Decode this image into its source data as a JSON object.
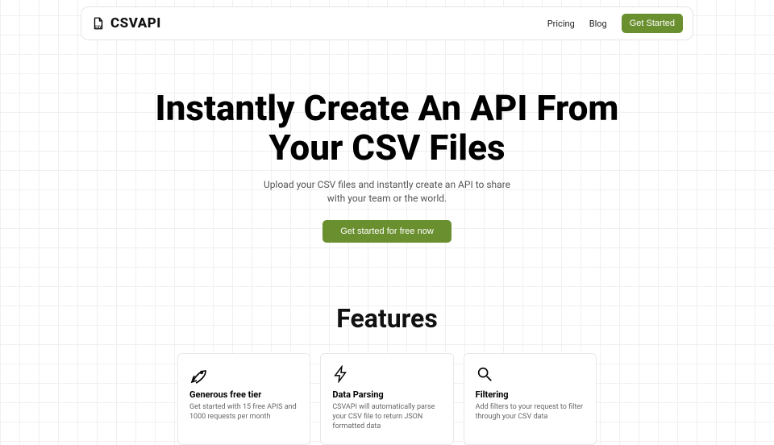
{
  "nav": {
    "brand": "CSVAPI",
    "links": {
      "pricing": "Pricing",
      "blog": "Blog"
    },
    "cta": "Get Started"
  },
  "hero": {
    "headline": "Instantly Create An API From Your CSV Files",
    "subheadline": "Upload your CSV files and instantly create an API to share with your team or the world.",
    "cta": "Get started for free now"
  },
  "features": {
    "title": "Features",
    "cards": [
      {
        "title": "Generous free tier",
        "desc": "Get started with 15 free APIS and 1000 requests per month"
      },
      {
        "title": "Data Parsing",
        "desc": "CSVAPI will automatically parse your CSV file to return JSON formatted data"
      },
      {
        "title": "Filtering",
        "desc": "Add filters to your request to filter through your CSV data"
      }
    ]
  },
  "colors": {
    "accent": "#6a8f2f"
  }
}
